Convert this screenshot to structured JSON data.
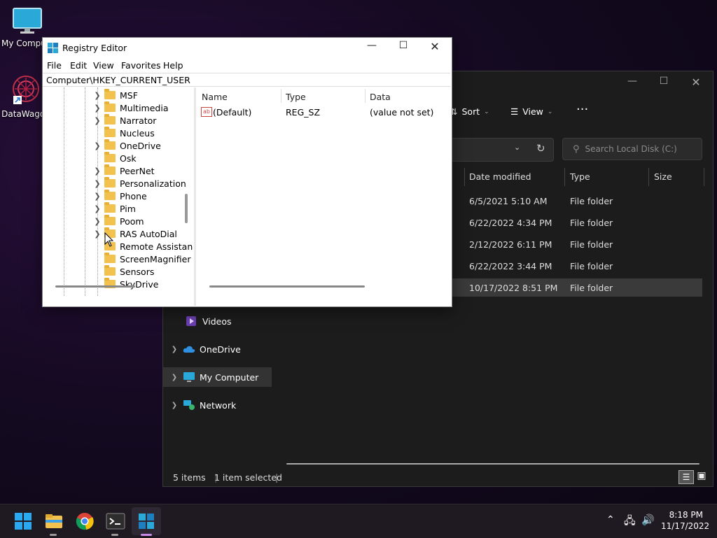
{
  "desktop": {
    "icons": [
      {
        "label": "My Computer"
      },
      {
        "label": "DataWagon"
      }
    ]
  },
  "explorer": {
    "toolbar": {
      "sort": "Sort",
      "view": "View",
      "more": "···"
    },
    "search_placeholder": "Search Local Disk (C:)",
    "columns": [
      "Date modified",
      "Type",
      "Size"
    ],
    "rows": [
      {
        "date": "6/5/2021 5:10 AM",
        "type": "File folder"
      },
      {
        "date": "6/22/2022 4:34 PM",
        "type": "File folder"
      },
      {
        "date": "2/12/2022 6:11 PM",
        "type": "File folder"
      },
      {
        "date": "6/22/2022 3:44 PM",
        "type": "File folder"
      },
      {
        "date": "10/17/2022 8:51 PM",
        "type": "File folder"
      }
    ],
    "nav": [
      {
        "label": "Videos"
      },
      {
        "label": "OneDrive"
      },
      {
        "label": "My Computer"
      },
      {
        "label": "Network"
      }
    ],
    "status": {
      "items": "5 items",
      "selected": "1 item selected"
    }
  },
  "regedit": {
    "title": "Registry Editor",
    "menu": [
      "File",
      "Edit",
      "View",
      "Favorites",
      "Help"
    ],
    "path": "Computer\\HKEY_CURRENT_USER",
    "tree": [
      {
        "label": "MSF",
        "expandable": true
      },
      {
        "label": "Multimedia",
        "expandable": true
      },
      {
        "label": "Narrator",
        "expandable": true
      },
      {
        "label": "Nucleus",
        "expandable": false
      },
      {
        "label": "OneDrive",
        "expandable": true
      },
      {
        "label": "Osk",
        "expandable": false
      },
      {
        "label": "PeerNet",
        "expandable": true
      },
      {
        "label": "Personalization",
        "expandable": true
      },
      {
        "label": "Phone",
        "expandable": true
      },
      {
        "label": "Pim",
        "expandable": true
      },
      {
        "label": "Poom",
        "expandable": true
      },
      {
        "label": "RAS AutoDial",
        "expandable": true
      },
      {
        "label": "Remote Assistance",
        "expandable": false
      },
      {
        "label": "ScreenMagnifier",
        "expandable": false
      },
      {
        "label": "Sensors",
        "expandable": false
      },
      {
        "label": "SkyDrive",
        "expandable": false
      }
    ],
    "value_columns": [
      "Name",
      "Type",
      "Data"
    ],
    "values": [
      {
        "name": "(Default)",
        "type": "REG_SZ",
        "data": "(value not set)"
      }
    ]
  },
  "taskbar": {
    "time": "8:18 PM",
    "date": "11/17/2022"
  }
}
